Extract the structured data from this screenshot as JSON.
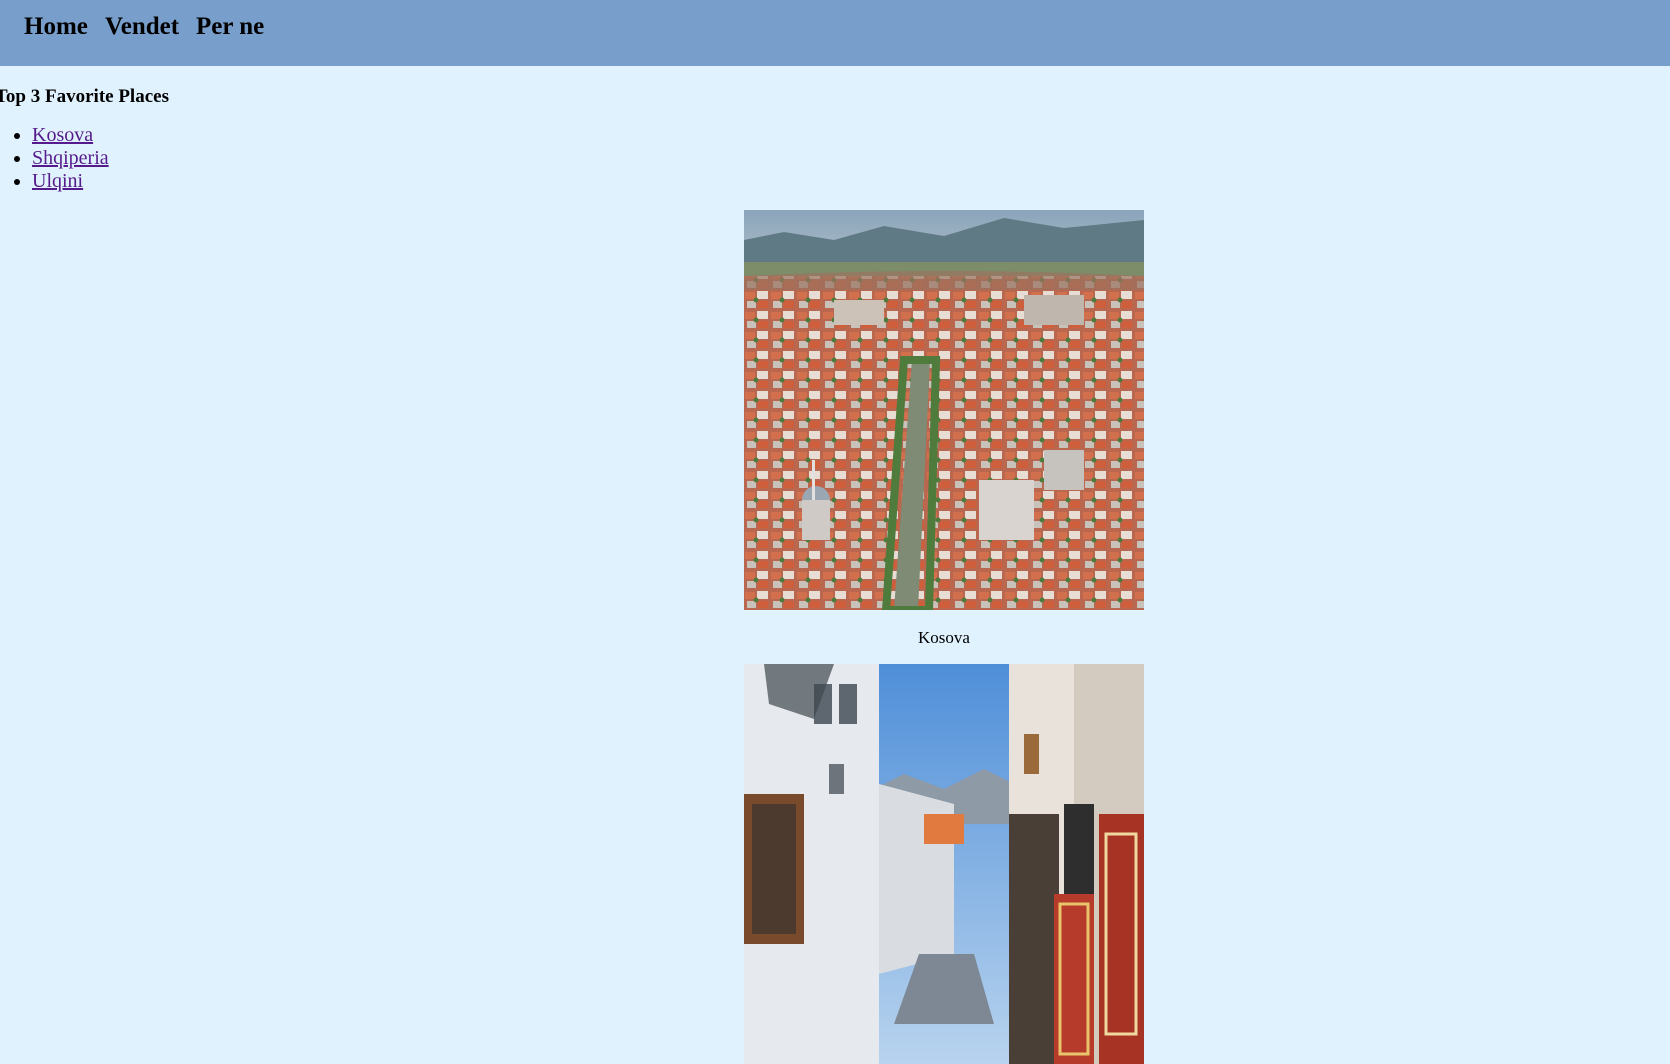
{
  "nav": {
    "home": "Home",
    "vendet": "Vendet",
    "per_ne": "Per ne"
  },
  "section_title": "Top 3 Favorite Places",
  "places": [
    {
      "label": "Kosova"
    },
    {
      "label": "Shqiperia"
    },
    {
      "label": "Ulqini"
    }
  ],
  "gallery": [
    {
      "caption": "Kosova",
      "image_subject": "aerial view of a city with red roofs, a river and a mosque dome, mountains behind"
    },
    {
      "caption": "",
      "image_subject": "narrow old-town street with white buildings, wooden balconies and hanging rugs"
    }
  ],
  "colors": {
    "navbar": "#789fcc",
    "page_background": "#dff2fd",
    "visited_link": "#551a8b"
  }
}
